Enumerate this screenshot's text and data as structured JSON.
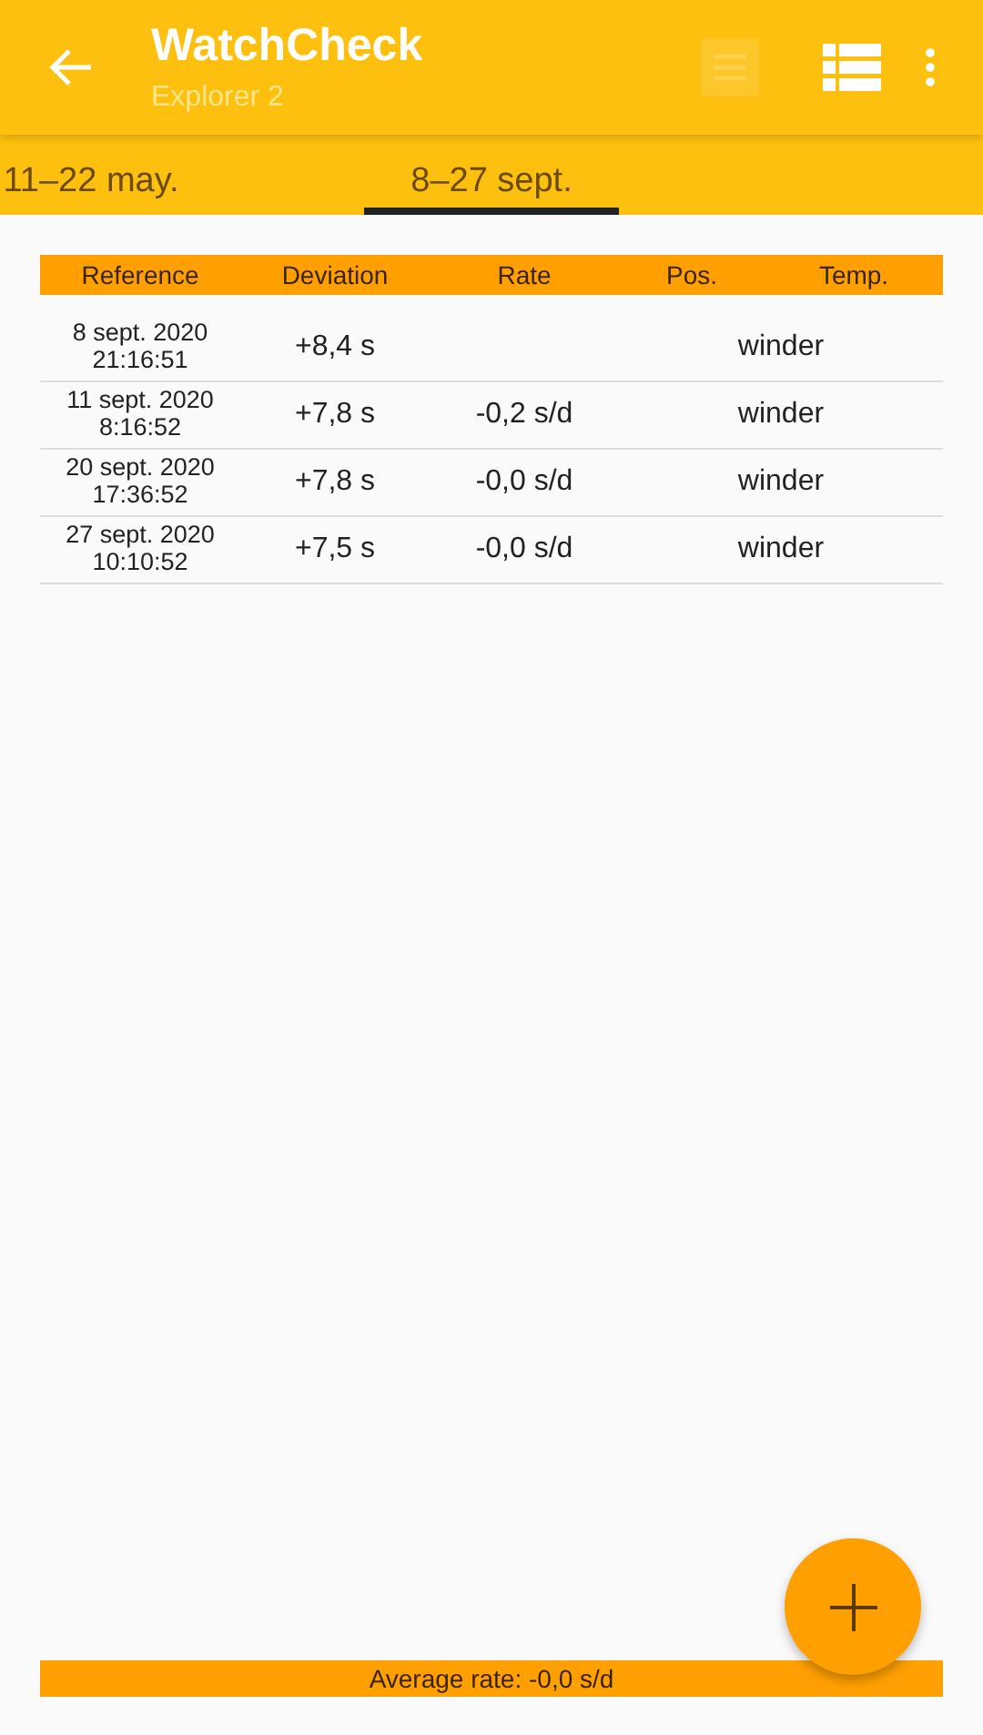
{
  "app_bar": {
    "title": "WatchCheck",
    "subtitle": "Explorer 2"
  },
  "view_toggles": [
    {
      "selected": false
    },
    {
      "selected": true
    }
  ],
  "tabs": [
    {
      "label": "11–22 may.",
      "selected": false
    },
    {
      "label": "8–27 sept.",
      "selected": true
    }
  ],
  "table": {
    "columns": [
      "Reference",
      "Deviation",
      "Rate",
      "Pos.",
      "Temp."
    ],
    "rows": [
      {
        "date": "8 sept. 2020",
        "time": "21:16:51",
        "deviation": "+8,4 s",
        "position": "winder"
      },
      {
        "date": "11 sept. 2020",
        "time": "8:16:52",
        "deviation": "+7,8 s",
        "rate": "-0,2 s/d",
        "position": "winder"
      },
      {
        "date": "20 sept. 2020",
        "time": "17:36:52",
        "deviation": "+7,8 s",
        "rate": "-0,0 s/d",
        "position": "winder"
      },
      {
        "date": "27 sept. 2020",
        "time": "10:10:52",
        "deviation": "+7,5 s",
        "rate": "-0,0 s/d",
        "position": "winder"
      }
    ]
  },
  "footer": "Average rate: -0,0 s/d"
}
